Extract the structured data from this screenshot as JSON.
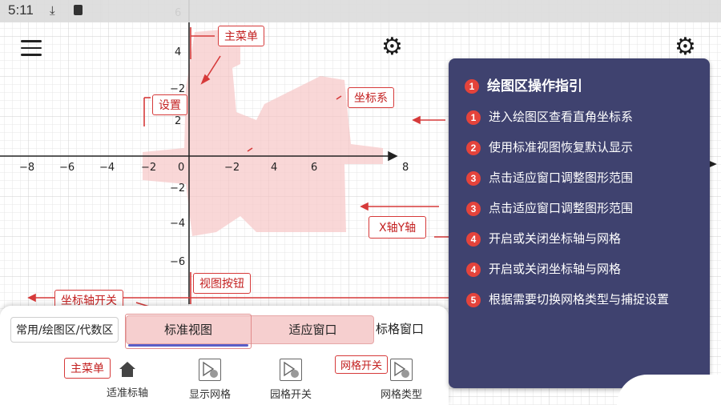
{
  "status": {
    "time": "5:11"
  },
  "graph": {
    "x_ticks": [
      "−8",
      "−6",
      "−4",
      "−2",
      "0",
      "−2",
      "4",
      "6",
      "8"
    ],
    "y_ticks": [
      "6",
      "4",
      "−2",
      "2",
      "−2",
      "−4",
      "−6"
    ]
  },
  "callouts": {
    "main_menu": "主菜单",
    "settings": "设置",
    "coord_system": "坐标系",
    "xy_axis": "X轴Y轴",
    "view_buttons": "视图按钮",
    "axis_toggle": "坐标轴开关",
    "main_menu_bottom": "主菜单",
    "grid_toggle": "网格开关"
  },
  "panel": {
    "title_num": "1",
    "title": "绘图区操作指引",
    "steps": [
      {
        "num": "1",
        "text": "进入绘图区查看直角坐标系"
      },
      {
        "num": "2",
        "text": "使用标准视图恢复默认显示"
      },
      {
        "num": "3",
        "text": "点击适应窗口调整图形范围"
      },
      {
        "num": "3",
        "text": "点击适应窗口调整图形范围"
      },
      {
        "num": "4",
        "text": "开启或关闭坐标轴与网格"
      },
      {
        "num": "4",
        "text": "开启或关闭坐标轴与网格"
      },
      {
        "num": "5",
        "text": "根据需要切换网格类型与捕捉设置"
      }
    ]
  },
  "toolbar": {
    "perspective": "常用/绘图区/代数区",
    "standard_view": "标准视图",
    "fit_window": "适应窗口",
    "axis_window": "标格窗口",
    "tools": [
      {
        "label": "适准标轴",
        "icon": "home-icon"
      },
      {
        "label": "显示网格",
        "icon": "grid-show-icon"
      },
      {
        "label": "园格开关",
        "icon": "grid-toggle-icon"
      },
      {
        "label": "网格类型",
        "icon": "grid-type-icon"
      }
    ]
  },
  "colors": {
    "accent": "#e4433b",
    "panel": "#3f426f",
    "callout": "#d63a3a"
  }
}
